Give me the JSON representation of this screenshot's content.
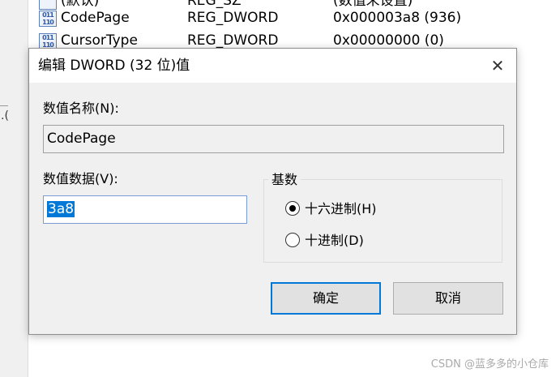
{
  "background": {
    "partial_left_text": ".(",
    "rows": [
      {
        "name": "(默认)",
        "type": "REG_SZ",
        "data": "(数值未设置)"
      },
      {
        "name": "CodePage",
        "type": "REG_DWORD",
        "data": "0x000003a8 (936)"
      },
      {
        "name": "CursorType",
        "type": "REG_DWORD",
        "data": "0x00000000 (0)"
      }
    ],
    "row_icon": "registry-binary-icon",
    "row_icon_glyph": "011\n110",
    "watermark": "CSDN @蓝多多的小仓库"
  },
  "dialog": {
    "title": "编辑 DWORD (32 位)值",
    "close_glyph": "✕",
    "value_name_label": "数值名称(N):",
    "value_name": "CodePage",
    "value_data_label": "数值数据(V):",
    "value_data": "3a8",
    "base_group_label": "基数",
    "radio_hex_label": "十六进制(H)",
    "radio_dec_label": "十进制(D)",
    "selected_base": "hex",
    "ok_label": "确定",
    "cancel_label": "取消"
  },
  "colors": {
    "accent": "#0078d7",
    "dialog_bg": "#f0f0f0"
  }
}
